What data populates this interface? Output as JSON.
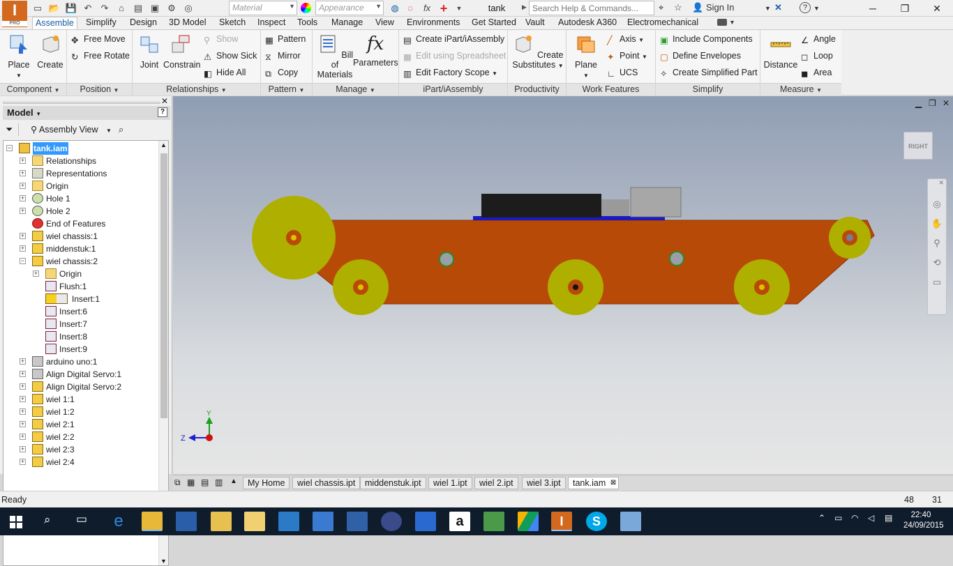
{
  "app": {
    "logo_text": "I",
    "edition": "PRO",
    "document_title": "tank"
  },
  "qat": {
    "material_placeholder": "Material",
    "appearance_placeholder": "Appearance"
  },
  "search": {
    "placeholder": "Search Help & Commands..."
  },
  "account": {
    "sign_in": "Sign In"
  },
  "ribbon_tabs": [
    "Assemble",
    "Simplify",
    "Design",
    "3D Model",
    "Sketch",
    "Inspect",
    "Tools",
    "Manage",
    "View",
    "Environments",
    "Get Started",
    "Vault",
    "Autodesk A360",
    "Electromechanical"
  ],
  "ribbon": {
    "component": {
      "title": "Component",
      "place": "Place",
      "create": "Create"
    },
    "position": {
      "title": "Position",
      "free_move": "Free Move",
      "free_rotate": "Free Rotate"
    },
    "relationships": {
      "title": "Relationships",
      "joint": "Joint",
      "constrain": "Constrain",
      "show": "Show",
      "show_sick": "Show Sick",
      "hide_all": "Hide All"
    },
    "pattern": {
      "title": "Pattern",
      "pattern": "Pattern",
      "mirror": "Mirror",
      "copy": "Copy"
    },
    "manage": {
      "title": "Manage",
      "bom_1": "Bill of",
      "bom_2": "Materials",
      "parameters": "Parameters"
    },
    "ipart": {
      "title": "iPart/iAssembly",
      "create": "Create iPart/iAssembly",
      "edit_spreadsheet": "Edit using Spreadsheet",
      "edit_factory": "Edit Factory Scope"
    },
    "productivity": {
      "title": "Productivity",
      "create_1": "Create",
      "create_2": "Substitutes"
    },
    "work_features": {
      "title": "Work Features",
      "plane": "Plane",
      "axis": "Axis",
      "point": "Point",
      "ucs": "UCS"
    },
    "simplify": {
      "title": "Simplify",
      "include": "Include Components",
      "envelopes": "Define Envelopes",
      "simplified": "Create Simplified Part"
    },
    "measure": {
      "title": "Measure",
      "distance": "Distance",
      "angle": "Angle",
      "loop": "Loop",
      "area": "Area"
    }
  },
  "browser": {
    "title": "Model",
    "view": "Assembly View",
    "tree": [
      {
        "label": "tank.iam",
        "level": 0,
        "icon": "assembly-icon",
        "expander": "minus",
        "selected": true
      },
      {
        "label": "Relationships",
        "level": 1,
        "icon": "folder-icon",
        "expander": "plus"
      },
      {
        "label": "Representations",
        "level": 1,
        "icon": "representations-icon",
        "expander": "plus"
      },
      {
        "label": "Origin",
        "level": 1,
        "icon": "folder-icon",
        "expander": "plus"
      },
      {
        "label": "Hole 1",
        "level": 1,
        "icon": "hole-icon",
        "expander": "plus"
      },
      {
        "label": "Hole 2",
        "level": 1,
        "icon": "hole-icon",
        "expander": "plus"
      },
      {
        "label": "End of Features",
        "level": 1,
        "icon": "end-of-features-icon",
        "expander": ""
      },
      {
        "label": "wiel chassis:1",
        "level": 1,
        "icon": "part-icon",
        "expander": "plus"
      },
      {
        "label": "middenstuk:1",
        "level": 1,
        "icon": "part-icon",
        "expander": "plus"
      },
      {
        "label": "wiel chassis:2",
        "level": 1,
        "icon": "part-icon",
        "expander": "minus"
      },
      {
        "label": "Origin",
        "level": 2,
        "icon": "folder-icon",
        "expander": "plus"
      },
      {
        "label": "Flush:1",
        "level": 2,
        "icon": "constraint-icon",
        "expander": ""
      },
      {
        "label": "Insert:1",
        "level": 2,
        "icon": "warning-constraint-icon",
        "expander": ""
      },
      {
        "label": "Insert:6",
        "level": 2,
        "icon": "constraint-icon",
        "expander": ""
      },
      {
        "label": "Insert:7",
        "level": 2,
        "icon": "constraint-icon",
        "expander": ""
      },
      {
        "label": "Insert:8",
        "level": 2,
        "icon": "constraint-icon",
        "expander": ""
      },
      {
        "label": "Insert:9",
        "level": 2,
        "icon": "constraint-icon",
        "expander": ""
      },
      {
        "label": "arduino uno:1",
        "level": 1,
        "icon": "subassembly-icon",
        "expander": "plus"
      },
      {
        "label": "Align Digital Servo:1",
        "level": 1,
        "icon": "subassembly-icon",
        "expander": "plus"
      },
      {
        "label": "Align Digital Servo:2",
        "level": 1,
        "icon": "part-icon",
        "expander": "plus"
      },
      {
        "label": "wiel 1:1",
        "level": 1,
        "icon": "part-icon",
        "expander": "plus"
      },
      {
        "label": "wiel 1:2",
        "level": 1,
        "icon": "part-icon",
        "expander": "plus"
      },
      {
        "label": "wiel 2:1",
        "level": 1,
        "icon": "part-icon",
        "expander": "plus"
      },
      {
        "label": "wiel 2:2",
        "level": 1,
        "icon": "part-icon",
        "expander": "plus"
      },
      {
        "label": "wiel 2:3",
        "level": 1,
        "icon": "part-icon",
        "expander": "plus"
      },
      {
        "label": "wiel 2:4",
        "level": 1,
        "icon": "part-icon",
        "expander": "plus"
      }
    ]
  },
  "viewport": {
    "viewcube_label": "RIGHT",
    "axis_y": "Y",
    "axis_z": "Z"
  },
  "doc_tabs": [
    "My Home",
    "wiel chassis.ipt",
    "middenstuk.ipt",
    "wiel 1.ipt",
    "wiel 2.ipt",
    "wiel 3.ipt",
    "tank.iam"
  ],
  "status": {
    "text": "Ready",
    "count1": "48",
    "count2": "31"
  },
  "clock": {
    "time": "22:40",
    "date": "24/09/2015"
  },
  "colors": {
    "chassis": "#b84a08",
    "wheel": "#afaf00",
    "accent": "#d2691e"
  }
}
